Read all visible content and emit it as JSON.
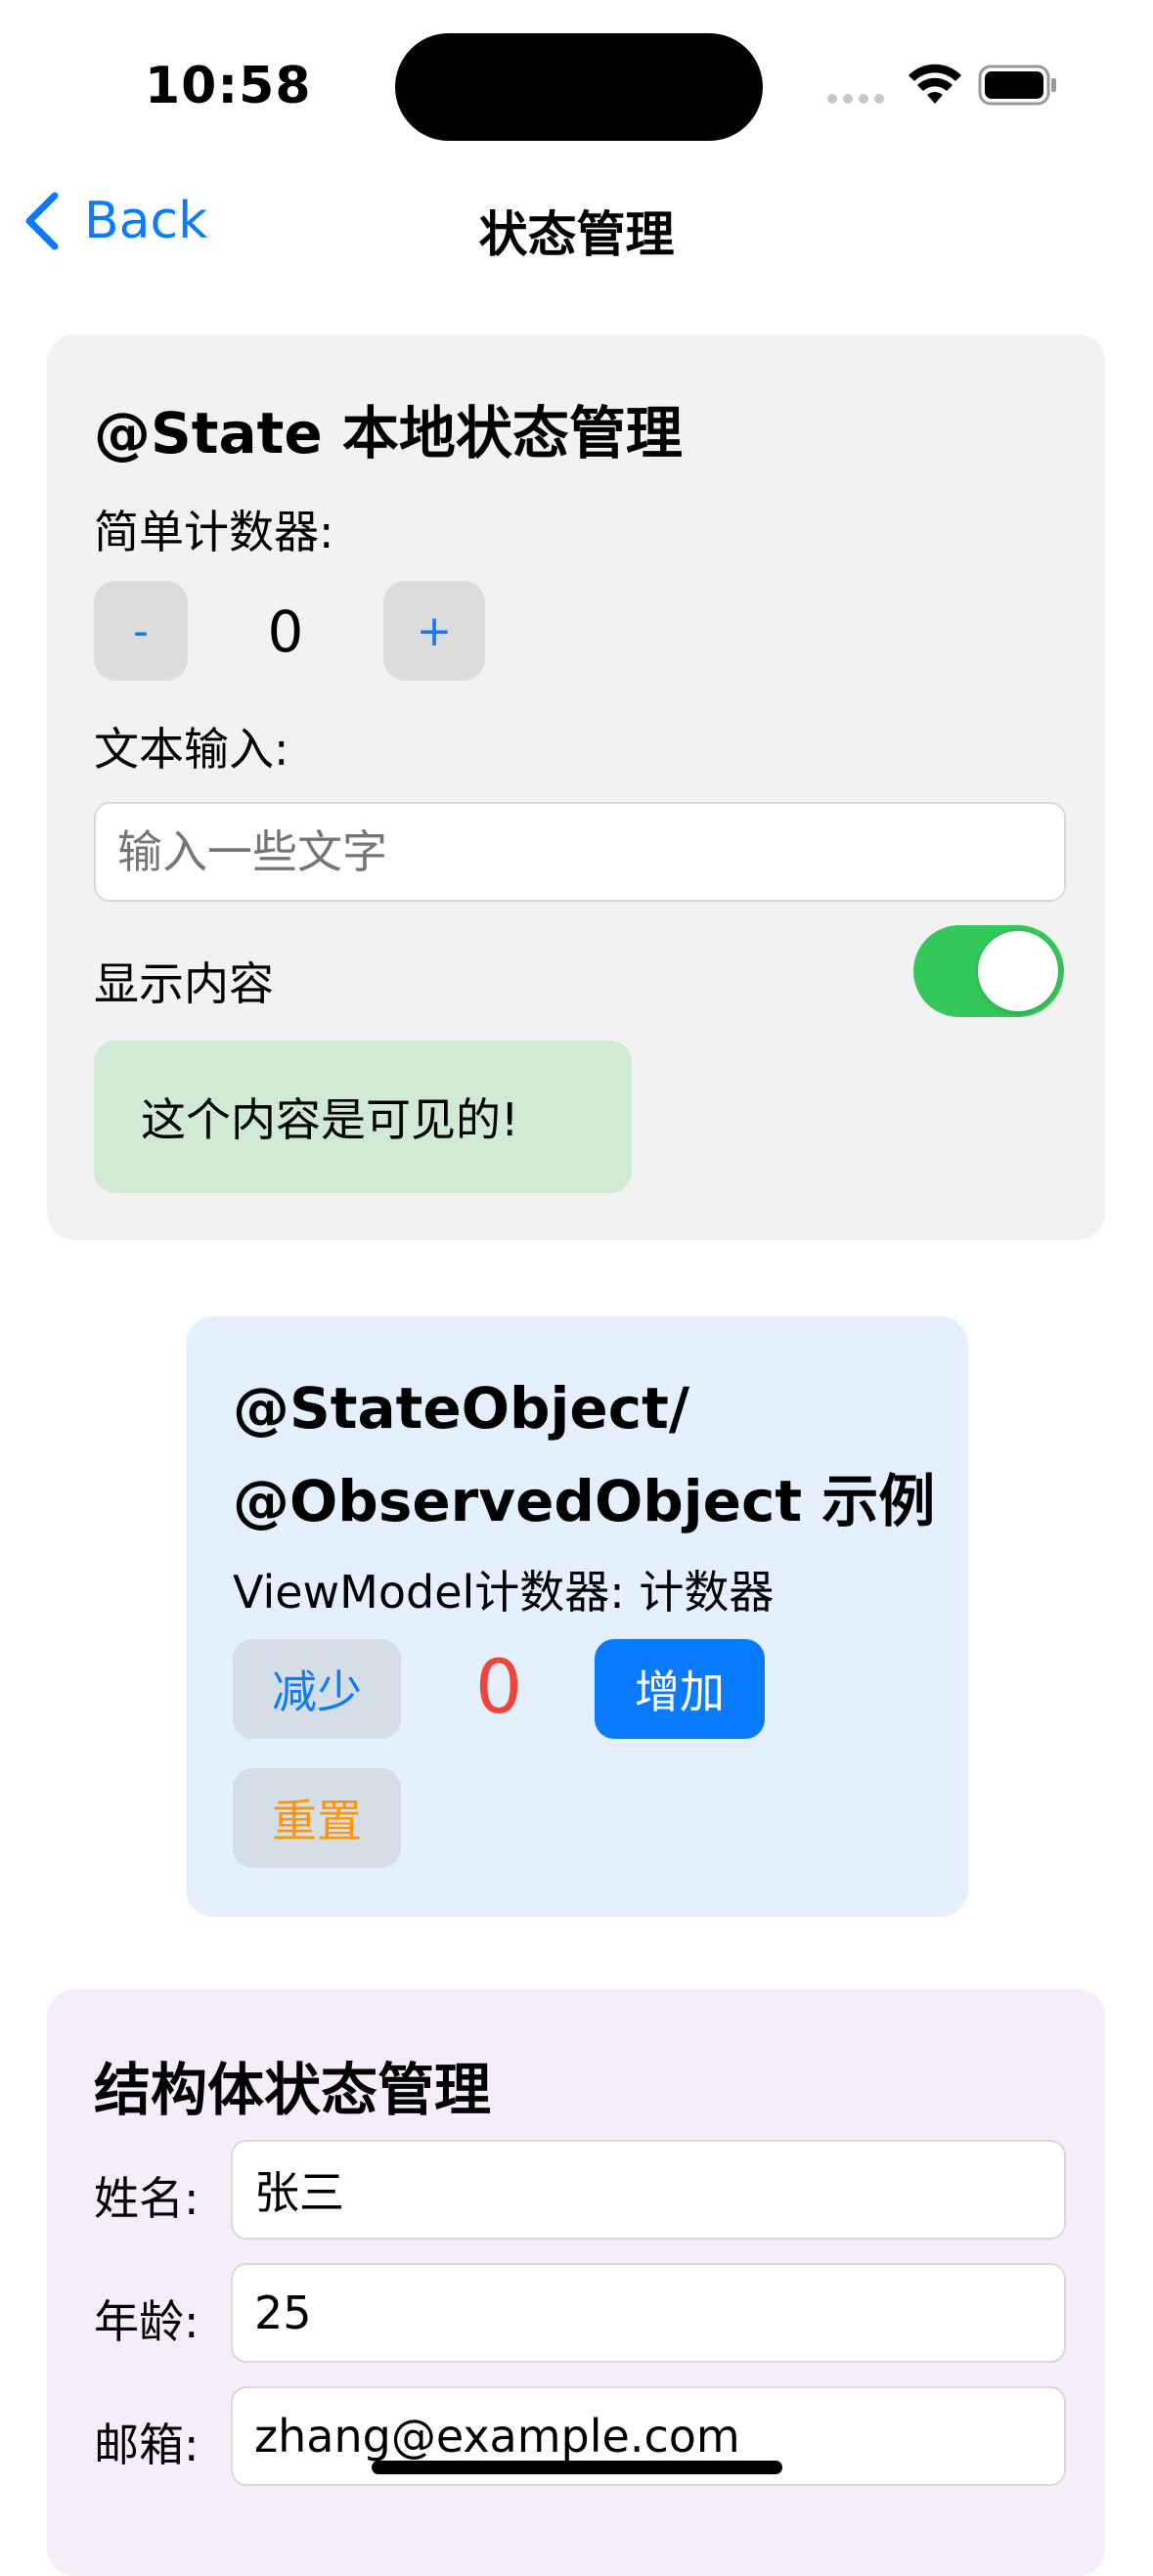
{
  "status_bar": {
    "time": "10:58"
  },
  "nav": {
    "back_label": "Back",
    "title": "状态管理"
  },
  "state_card": {
    "title": "@State 本地状态管理",
    "counter_label": "简单计数器:",
    "minus_label": "-",
    "count_value": "0",
    "plus_label": "+",
    "text_input_label": "文本输入:",
    "text_input_value": "",
    "text_input_placeholder": "输入一些文字",
    "show_content_label": "显示内容",
    "show_content_on": true,
    "visible_content": "这个内容是可见的!"
  },
  "observed_card": {
    "title_line1": "@StateObject/",
    "title_line2": "@ObservedObject 示例",
    "subtitle": "ViewModel计数器: 计数器",
    "decrease_label": "减少",
    "count_value": "0",
    "increase_label": "增加",
    "reset_label": "重置"
  },
  "struct_card": {
    "title": "结构体状态管理",
    "fields": [
      {
        "label": "姓名:",
        "value": "张三"
      },
      {
        "label": "年龄:",
        "value": "25"
      },
      {
        "label": "邮箱:",
        "value": "zhang@example.com"
      }
    ]
  },
  "colors": {
    "accent": "#0a7aff",
    "toggle_on": "#34c759",
    "counter_red": "#f0443a",
    "reset_orange": "#ff9500"
  }
}
